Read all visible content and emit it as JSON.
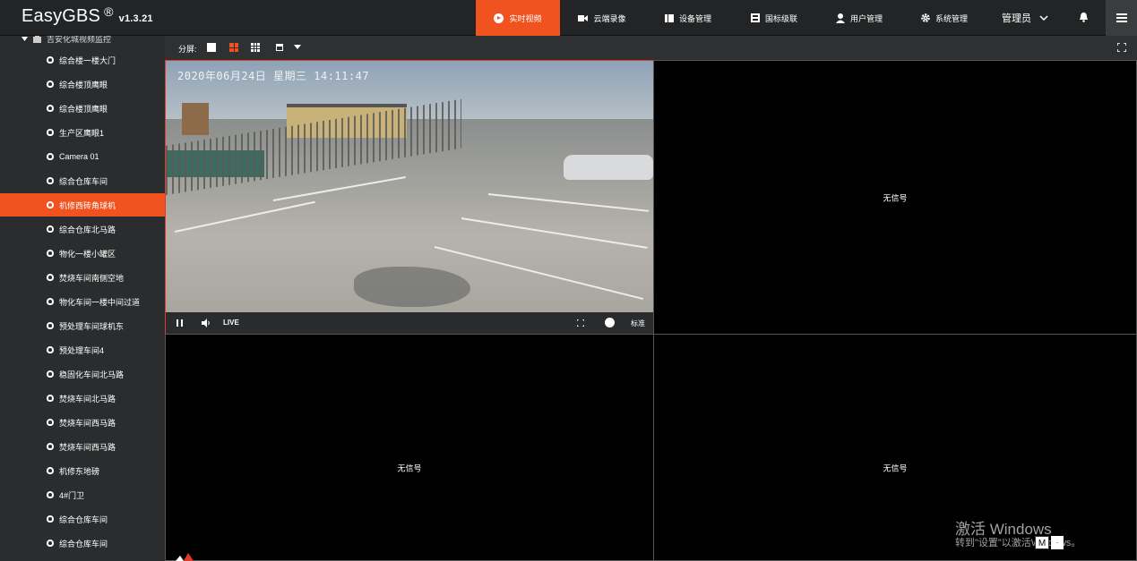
{
  "app": {
    "name": "EasyGBS",
    "reg": "®",
    "version": "v1.3.21"
  },
  "nav": {
    "items": [
      {
        "label": "实时视频",
        "icon": "play-circle-icon",
        "active": true
      },
      {
        "label": "云端录像",
        "icon": "video-camera-icon",
        "active": false
      },
      {
        "label": "设备管理",
        "icon": "device-icon",
        "active": false
      },
      {
        "label": "国标级联",
        "icon": "cascade-icon",
        "active": false
      },
      {
        "label": "用户管理",
        "icon": "user-icon",
        "active": false
      },
      {
        "label": "系统管理",
        "icon": "gear-icon",
        "active": false
      }
    ],
    "user": "管理员",
    "accent": "#f0531f"
  },
  "sidebar": {
    "root": "吉安化城视频监控",
    "items": [
      {
        "label": "综合楼一楼大门"
      },
      {
        "label": "综合楼顶鹰眼"
      },
      {
        "label": "综合楼顶鹰眼"
      },
      {
        "label": "生产区鹰眼1"
      },
      {
        "label": "Camera 01"
      },
      {
        "label": "综合仓库车间"
      },
      {
        "label": "机修西砖角球机",
        "active": true
      },
      {
        "label": "综合仓库北马路"
      },
      {
        "label": "物化一楼小罐区"
      },
      {
        "label": "焚烧车间南侧空地"
      },
      {
        "label": "物化车间一楼中间过道"
      },
      {
        "label": "预处理车间球机东"
      },
      {
        "label": "预处理车间4"
      },
      {
        "label": "稳固化车间北马路"
      },
      {
        "label": "焚烧车间北马路"
      },
      {
        "label": "焚烧车间西马路"
      },
      {
        "label": "焚烧车间西马路"
      },
      {
        "label": "机修东地磅"
      },
      {
        "label": "4#门卫"
      },
      {
        "label": "综合仓库车间"
      },
      {
        "label": "综合仓库车间"
      }
    ]
  },
  "toolbar": {
    "split_label": "分屏:"
  },
  "player": {
    "timestamp": "2020年06月24日 星期三 14:11:47",
    "live": "LIVE",
    "quality": "标准"
  },
  "cells": {
    "no_signal": "无信号"
  },
  "os": {
    "activate_title": "激活 Windows",
    "activate_hint": "转到\"设置\"以激活Windows。",
    "ime": "M",
    "ime_adj": "·"
  }
}
